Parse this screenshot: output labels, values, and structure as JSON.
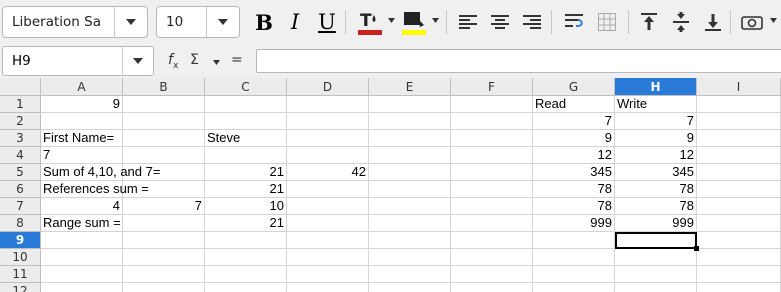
{
  "toolbar": {
    "font_name": "Liberation Sa",
    "font_size": "10",
    "buttons": [
      {
        "name": "bold-icon",
        "glyph": "B"
      },
      {
        "name": "italic-icon",
        "glyph": "I"
      },
      {
        "name": "underline-icon",
        "glyph": "U"
      }
    ],
    "font_color": "#c9211e",
    "highlight_color": "#ffff00"
  },
  "formula_bar": {
    "name_box": "H9",
    "fx_label": "f",
    "fx_sub": "x",
    "sum_label": "Σ",
    "equals_label": "=",
    "formula": ""
  },
  "sheet": {
    "columns": [
      "A",
      "B",
      "C",
      "D",
      "E",
      "F",
      "G",
      "H",
      "I"
    ],
    "selected_column": "H",
    "rows": [
      "1",
      "2",
      "3",
      "4",
      "5",
      "6",
      "7",
      "8",
      "9",
      "10",
      "11",
      "12"
    ],
    "selected_row": "9",
    "active_cell": "H9",
    "cells": [
      {
        "ref": "A1",
        "value": "9",
        "align": "num"
      },
      {
        "ref": "G1",
        "value": "Read",
        "align": "txt"
      },
      {
        "ref": "H1",
        "value": "Write",
        "align": "txt"
      },
      {
        "ref": "G2",
        "value": "7",
        "align": "num"
      },
      {
        "ref": "H2",
        "value": "7",
        "align": "num"
      },
      {
        "ref": "A3",
        "value": "First Name=",
        "align": "txt"
      },
      {
        "ref": "C3",
        "value": "Steve",
        "align": "txt"
      },
      {
        "ref": "G3",
        "value": "9",
        "align": "num"
      },
      {
        "ref": "H3",
        "value": "9",
        "align": "num"
      },
      {
        "ref": "A4",
        "value": "7",
        "align": "txt"
      },
      {
        "ref": "G4",
        "value": "12",
        "align": "num"
      },
      {
        "ref": "H4",
        "value": "12",
        "align": "num"
      },
      {
        "ref": "A5",
        "value": "Sum of 4,10, and 7=",
        "align": "txt"
      },
      {
        "ref": "C5",
        "value": "21",
        "align": "num"
      },
      {
        "ref": "D5",
        "value": "42",
        "align": "num"
      },
      {
        "ref": "G5",
        "value": "345",
        "align": "num"
      },
      {
        "ref": "H5",
        "value": "345",
        "align": "num"
      },
      {
        "ref": "A6",
        "value": "References sum =",
        "align": "txt"
      },
      {
        "ref": "C6",
        "value": "21",
        "align": "num"
      },
      {
        "ref": "G6",
        "value": "78",
        "align": "num"
      },
      {
        "ref": "H6",
        "value": "78",
        "align": "num"
      },
      {
        "ref": "A7",
        "value": "4",
        "align": "num"
      },
      {
        "ref": "B7",
        "value": "7",
        "align": "num"
      },
      {
        "ref": "C7",
        "value": "10",
        "align": "num"
      },
      {
        "ref": "G7",
        "value": "78",
        "align": "num"
      },
      {
        "ref": "H7",
        "value": "78",
        "align": "num"
      },
      {
        "ref": "A8",
        "value": "Range sum =",
        "align": "txt"
      },
      {
        "ref": "C8",
        "value": "21",
        "align": "num"
      },
      {
        "ref": "G8",
        "value": "999",
        "align": "num"
      },
      {
        "ref": "H8",
        "value": "999",
        "align": "num"
      }
    ]
  }
}
